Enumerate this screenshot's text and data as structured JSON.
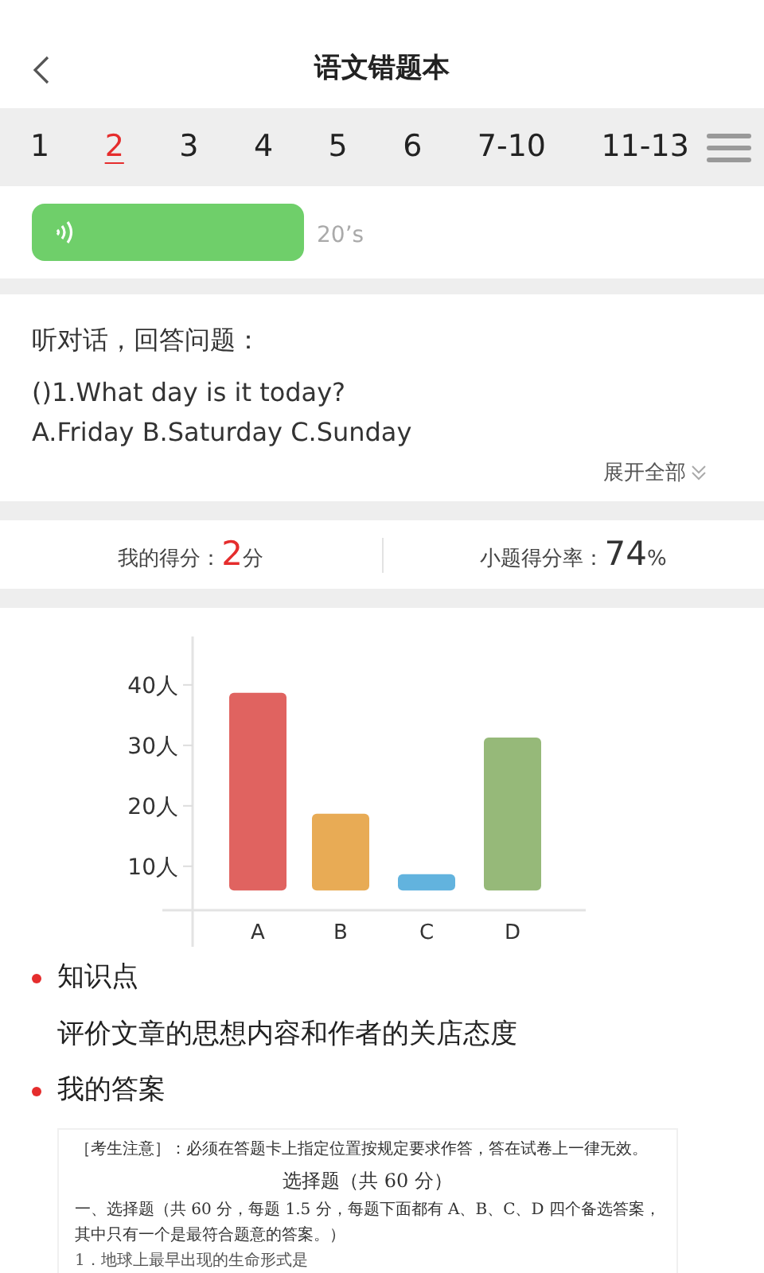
{
  "header": {
    "title": "语文错题本"
  },
  "question_tabs": [
    {
      "label": "1",
      "selected": false
    },
    {
      "label": "2",
      "selected": true
    },
    {
      "label": "3",
      "selected": false
    },
    {
      "label": "4",
      "selected": false
    },
    {
      "label": "5",
      "selected": false
    },
    {
      "label": "6",
      "selected": false
    },
    {
      "label": "7-10",
      "selected": false
    },
    {
      "label": "11-13",
      "selected": false
    }
  ],
  "audio": {
    "duration": "20’s"
  },
  "question": {
    "prompt": "听对话，回答问题：",
    "lines": [
      "()1.What day is it today?",
      "A.Friday B.Saturday C.Sunday"
    ],
    "expand_label": "展开全部"
  },
  "score": {
    "my_score_label": "我的得分：",
    "my_score": "2",
    "my_score_unit": "分",
    "rate_label": "小题得分率：",
    "rate": "74",
    "rate_unit": "%"
  },
  "chart_data": {
    "type": "bar",
    "categories": [
      "A",
      "B",
      "C",
      "D"
    ],
    "ylim": [
      6,
      48
    ],
    "yticks": [
      {
        "value": 10,
        "label": "10人"
      },
      {
        "value": 20,
        "label": "20人"
      },
      {
        "value": 30,
        "label": "30人"
      },
      {
        "value": 40,
        "label": "40人"
      }
    ],
    "series": [
      {
        "color": "#e06360",
        "values": [
          38.7,
          null,
          null,
          null
        ]
      },
      {
        "color": "#e8ab55",
        "values": [
          null,
          18.7,
          null,
          null
        ]
      },
      {
        "color": "#62b3de",
        "values": [
          null,
          null,
          8.7,
          null
        ]
      },
      {
        "color": "#96b979",
        "values": [
          null,
          null,
          null,
          31.3
        ]
      }
    ]
  },
  "sections": [
    {
      "heading": "知识点",
      "body": "评价文章的思想内容和作者的关店态度"
    },
    {
      "heading": "我的答案"
    }
  ],
  "answer_document": {
    "notice": "［考生注意］：必须在答题卡上指定位置按规定要求作答，答在试卷上一律无效。",
    "title": "选择题（共 60 分）",
    "instruction": "一、选择题（共 60 分，每题 1.5 分，每题下面都有 A、B、C、D 四个备选答案，其中只有一个是最符合题意的答案。）",
    "first_question": "1．地球上最早出现的生命形式是"
  }
}
